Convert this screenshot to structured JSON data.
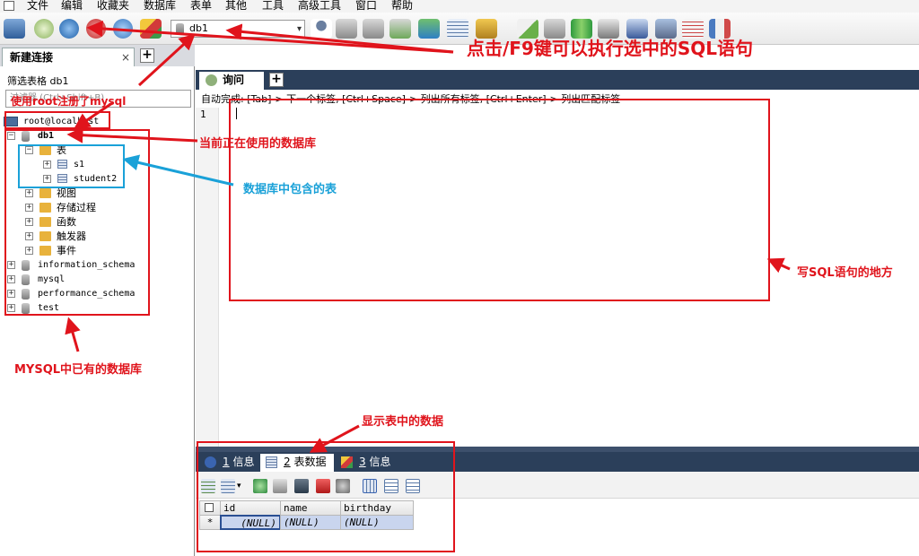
{
  "menubar": {
    "items": [
      "文件",
      "编辑",
      "收藏夹",
      "数据库",
      "表单",
      "其他",
      "工具",
      "高级工具",
      "窗口",
      "帮助"
    ]
  },
  "toolbar": {
    "selected_database": "db1",
    "icons": [
      "connect-icon",
      "new-connection-icon",
      "execute-query-icon",
      "stop-icon",
      "refresh-icon",
      "shapes-icon",
      "user-icon",
      "create-db-icon",
      "import-db-icon",
      "export-db-icon",
      "copy-db-icon",
      "schema-sync-icon",
      "structure-icon",
      "bookmark-icon",
      "eraser-icon",
      "db-backup-icon",
      "compare-icon",
      "transfer-icon",
      "server-monitor-icon",
      "screen-icon",
      "schedule-icon",
      "diagram-icon"
    ]
  },
  "left_tabs": {
    "active_label": "新建连接",
    "close_glyph": "×",
    "plus_glyph": "+"
  },
  "left_panel": {
    "filter_label": "筛选表格 db1",
    "filter_placeholder": "过滤器 (Ctrl+Shift+B)",
    "server": "root@localhost",
    "tree": [
      {
        "level": 0,
        "type": "db",
        "label": "db1",
        "expanded": true,
        "bold": true
      },
      {
        "level": 1,
        "type": "folder",
        "label": "表",
        "expanded": true
      },
      {
        "level": 2,
        "type": "table",
        "label": "s1"
      },
      {
        "level": 2,
        "type": "table",
        "label": "student2"
      },
      {
        "level": 1,
        "type": "folder",
        "label": "视图"
      },
      {
        "level": 1,
        "type": "folder",
        "label": "存储过程"
      },
      {
        "level": 1,
        "type": "folder",
        "label": "函数"
      },
      {
        "level": 1,
        "type": "folder",
        "label": "触发器"
      },
      {
        "level": 1,
        "type": "folder",
        "label": "事件"
      },
      {
        "level": 0,
        "type": "db",
        "label": "information_schema"
      },
      {
        "level": 0,
        "type": "db",
        "label": "mysql"
      },
      {
        "level": 0,
        "type": "db",
        "label": "performance_schema"
      },
      {
        "level": 0,
        "type": "db",
        "label": "test"
      }
    ]
  },
  "query_tabs": {
    "active_label": "询问",
    "plus_glyph": "+"
  },
  "editor": {
    "autocomplete_hint": "自动完成: [Tab]-> 下一个标签, [Ctrl+Space]-> 列出所有标签, [Ctrl+Enter]-> 列出匹配标签",
    "line_number": "1"
  },
  "result_tabs": [
    {
      "num": "1",
      "label": "信息",
      "active": false
    },
    {
      "num": "2",
      "label": "表数据",
      "active": true
    },
    {
      "num": "3",
      "label": "信息",
      "active": false
    }
  ],
  "result_grid": {
    "row_marker": "*",
    "columns": [
      "id",
      "name",
      "birthday"
    ],
    "rows": [
      [
        "(NULL)",
        "(NULL)",
        "(NULL)"
      ]
    ]
  },
  "annotations": {
    "f9_execute": "点击/F9键可以执行选中的SQL语句",
    "root_login": "使用root注册了mysql",
    "current_db": "当前正在使用的数据库",
    "tables_in_db": "数据库中包含的表",
    "write_sql": "写SQL语句的地方",
    "existing_dbs": "MYSQL中已有的数据库",
    "show_table_data": "显示表中的数据",
    "colors": {
      "red": "#e0141c",
      "blue": "#1aa1d8"
    }
  }
}
